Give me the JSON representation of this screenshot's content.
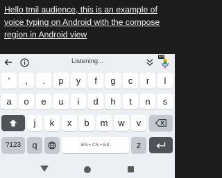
{
  "editor": {
    "text": "Hello tmil audience, this is an example of voice typing on Android with the compose region in Android view"
  },
  "toolbar": {
    "back_icon": "arrow-left-icon",
    "info_icon": "info-icon",
    "status": "Listening...",
    "collapse_icon": "double-chevron-down-icon",
    "mic_icon": "microphone-icon",
    "language_badge": "EN"
  },
  "keyboard": {
    "row1": [
      "'",
      ",",
      ".",
      "p",
      "y",
      "f",
      "g",
      "c",
      "r",
      "l"
    ],
    "row1_sub": [
      "",
      "",
      "",
      "",
      "",
      "",
      "",
      "",
      "",
      ""
    ],
    "row2": [
      "a",
      "o",
      "e",
      "u",
      "i",
      "d",
      "h",
      "t",
      "n",
      "s"
    ],
    "row3": [
      "j",
      "k",
      "x",
      "b",
      "m",
      "w",
      "v"
    ],
    "shift_icon": "shift-icon",
    "backspace_icon": "backspace-icon",
    "symbols_label": "?123",
    "q_label": "q",
    "globe_icon": "globe-icon",
    "space_label": "EN • CS • ES",
    "z_label": "z",
    "enter_icon": "enter-icon"
  },
  "navbar": {
    "back_icon": "nav-back-icon",
    "home_icon": "nav-home-icon",
    "recents_icon": "nav-recents-icon"
  }
}
